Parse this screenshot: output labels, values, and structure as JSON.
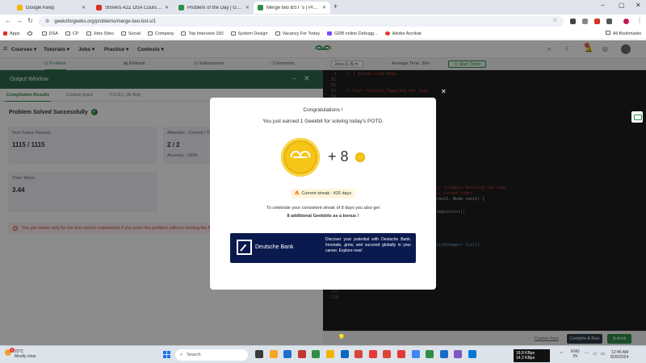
{
  "browser": {
    "tabs": [
      {
        "label": "Google Keep",
        "color": "#f6b400",
        "active": false
      },
      {
        "label": "Strivers A2Z DSA Course/Sheet",
        "color": "#d93025",
        "active": false
      },
      {
        "label": "Problem of the Day | GeeksforG",
        "color": "#2f8d46",
        "active": false
      },
      {
        "label": "Merge two BST 's | Practice | G",
        "color": "#2f8d46",
        "active": true
      }
    ],
    "url": "geeksforgeeks.org/problems/merge-two-bst-s/1",
    "bookmarks": [
      "Apps",
      "DSA",
      "CP",
      "Jobs Sites",
      "Social",
      "Company",
      "Top Interview 150",
      "System Design",
      "Vacancy For Today",
      "GDB online Debugg...",
      "Adobe Acrobat"
    ],
    "all_bookmarks": "All Bookmarks"
  },
  "site": {
    "menu": [
      "Courses",
      "Tutorials",
      "Jobs",
      "Practice",
      "Contests"
    ],
    "notification_count": "23",
    "problem_tabs": [
      "Problem",
      "Editorial",
      "Submissions",
      "Comments"
    ]
  },
  "editor": {
    "language": "Java (1.8)",
    "avg_time": "Average Time: 30m",
    "start_timer": "Start Timer",
    "line_numbers": [
      "1",
      "81",
      "82",
      "83",
      "84",
      "85"
    ],
    "last_lines": [
      "117",
      "118"
    ],
    "code_lines": [
      {
        "text": "// } Driver Code Ends",
        "color": "#d04040"
      },
      {
        "text": "// User function Template for Java",
        "color": "#d04040"
      },
      {
        "text": "// integers denoting the node",
        "color": "#d04040"
      },
      {
        "text": "// sorted order.",
        "color": "#d04040"
      },
      {
        "text": "root1, Node root2) {",
        "color": "#cfcfcf"
      },
      {
        "text": "rayList<>();",
        "color": "#cfcfcf"
      },
      {
        "text": "st<Integer> list){",
        "color": "#7fb5e6"
      }
    ],
    "custom_input": "Custom Input",
    "compile_run": "Compile & Run",
    "submit": "Submit"
  },
  "output": {
    "title": "Output Window",
    "tabs": [
      "Compilation Results",
      "Custom Input",
      "Y.O.G.I. (AI Bot)"
    ],
    "status": "Problem Solved Successfully",
    "test_cases_label": "Test Cases Passed",
    "test_cases_value": "1115 / 1115",
    "attempts_label": "Attempts : Correct / Total",
    "attempts_value": "2 / 2",
    "accuracy": "Accuracy : 100%",
    "time_label": "Time Taken",
    "time_value": "3.44",
    "warning": "You get marks only for the first correct submission if you solve the problem without viewing the full solution."
  },
  "modal": {
    "congrats": "Congratulations !",
    "earned": "You just earned 1 Geekbit for solving today's POTD.",
    "plus": "+ 8",
    "streak": "Current streak : 426 days",
    "celebrate": "To celebrate your consistent streak of 8 days you also get",
    "bonus": "8 additional Geekbits as a bonus !",
    "ad_brand": "Deutsche Bank",
    "ad_text": "Discover your potential with Deutsche Bank. Innovate, grow, and succeed globally in your career. Explore now!"
  },
  "taskbar": {
    "temp": "22°C",
    "weather": "Mostly clear",
    "weather_badge": "1",
    "search": "Search",
    "net_up": "18.8 KBps",
    "net_down": "14.2 KBps",
    "lang": "ENG",
    "lang_region": "IN",
    "time": "12:45 AM",
    "date": "8/30/2024",
    "app_colors": [
      "#3a3a3a",
      "#f5a623",
      "#1f6fd1",
      "#c0392b",
      "#2f8d46",
      "#f4b400",
      "#0a66c2",
      "#d44638",
      "#e53935",
      "#db4437",
      "#e53935",
      "#4285f4",
      "#2f8d46",
      "#1b6ac9",
      "#7e57c2",
      "#0078d4"
    ]
  }
}
